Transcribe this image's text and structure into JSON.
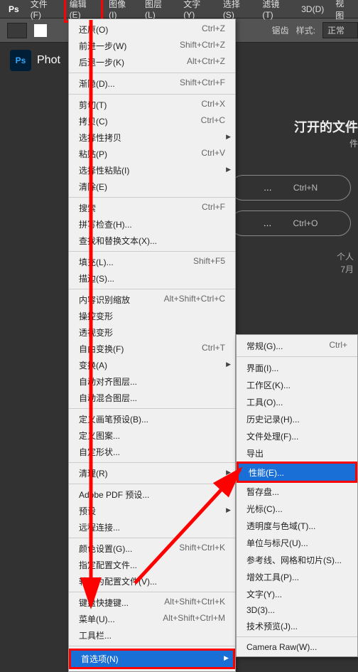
{
  "menubar": {
    "items": [
      "文件(F)",
      "编辑(E)",
      "图像(I)",
      "图层(L)",
      "文字(Y)",
      "选择(S)",
      "滤镜(T)",
      "3D(D)",
      "视图"
    ]
  },
  "toolbar": {
    "select_label": "样式:",
    "select_value": "正常"
  },
  "app": {
    "logo_text": "Ps",
    "name": "Phot"
  },
  "right": {
    "heading": "汀开的文件",
    "sub": "件",
    "pill1": "…",
    "pill1_shortcut": "Ctrl+N",
    "pill2": "…",
    "pill2_shortcut": "Ctrl+O",
    "small1": "个人",
    "small2": "7月"
  },
  "menu": {
    "sections": [
      [
        {
          "label": "还原(O)",
          "shortcut": "Ctrl+Z"
        },
        {
          "label": "前进一步(W)",
          "shortcut": "Shift+Ctrl+Z"
        },
        {
          "label": "后退一步(K)",
          "shortcut": "Alt+Ctrl+Z"
        }
      ],
      [
        {
          "label": "渐隐(D)...",
          "shortcut": "Shift+Ctrl+F"
        }
      ],
      [
        {
          "label": "剪切(T)",
          "shortcut": "Ctrl+X"
        },
        {
          "label": "拷贝(C)",
          "shortcut": "Ctrl+C"
        },
        {
          "label": "选择性拷贝",
          "sub": true
        },
        {
          "label": "粘贴(P)",
          "shortcut": "Ctrl+V"
        },
        {
          "label": "选择性粘贴(I)",
          "sub": true
        },
        {
          "label": "清除(E)"
        }
      ],
      [
        {
          "label": "搜索",
          "shortcut": "Ctrl+F"
        },
        {
          "label": "拼写检查(H)..."
        },
        {
          "label": "查找和替换文本(X)..."
        }
      ],
      [
        {
          "label": "填充(L)...",
          "shortcut": "Shift+F5"
        },
        {
          "label": "描边(S)..."
        }
      ],
      [
        {
          "label": "内容识别缩放",
          "shortcut": "Alt+Shift+Ctrl+C"
        },
        {
          "label": "操控变形"
        },
        {
          "label": "透视变形"
        },
        {
          "label": "自由变换(F)",
          "shortcut": "Ctrl+T"
        },
        {
          "label": "变换(A)",
          "sub": true
        },
        {
          "label": "自动对齐图层..."
        },
        {
          "label": "自动混合图层..."
        }
      ],
      [
        {
          "label": "定义画笔预设(B)..."
        },
        {
          "label": "定义图案..."
        },
        {
          "label": "自定形状..."
        }
      ],
      [
        {
          "label": "清理(R)",
          "sub": true
        }
      ],
      [
        {
          "label": "Adobe PDF 预设..."
        },
        {
          "label": "预设",
          "sub": true
        },
        {
          "label": "远程连接..."
        }
      ],
      [
        {
          "label": "颜色设置(G)...",
          "shortcut": "Shift+Ctrl+K"
        },
        {
          "label": "指定配置文件..."
        },
        {
          "label": "转换为配置文件(V)..."
        }
      ],
      [
        {
          "label": "键盘快捷键...",
          "shortcut": "Alt+Shift+Ctrl+K"
        },
        {
          "label": "菜单(U)...",
          "shortcut": "Alt+Shift+Ctrl+M"
        },
        {
          "label": "工具栏..."
        }
      ],
      [
        {
          "label": "首选项(N)",
          "sub": true,
          "selected": true,
          "redbox": true
        }
      ]
    ]
  },
  "submenu": {
    "sections": [
      [
        {
          "label": "常规(G)...",
          "shortcut": "Ctrl+"
        }
      ],
      [
        {
          "label": "界面(I)..."
        },
        {
          "label": "工作区(K)..."
        },
        {
          "label": "工具(O)..."
        },
        {
          "label": "历史记录(H)..."
        },
        {
          "label": "文件处理(F)..."
        },
        {
          "label": "导出"
        },
        {
          "label": "性能(E)...",
          "selected": true,
          "redbox": true
        },
        {
          "label": "暂存盘..."
        },
        {
          "label": "光标(C)..."
        },
        {
          "label": "透明度与色域(T)..."
        },
        {
          "label": "单位与标尺(U)..."
        },
        {
          "label": "参考线、网格和切片(S)..."
        },
        {
          "label": "增效工具(P)..."
        },
        {
          "label": "文字(Y)..."
        },
        {
          "label": "3D(3)..."
        },
        {
          "label": "技术预览(J)..."
        }
      ],
      [
        {
          "label": "Camera Raw(W)..."
        }
      ]
    ]
  }
}
